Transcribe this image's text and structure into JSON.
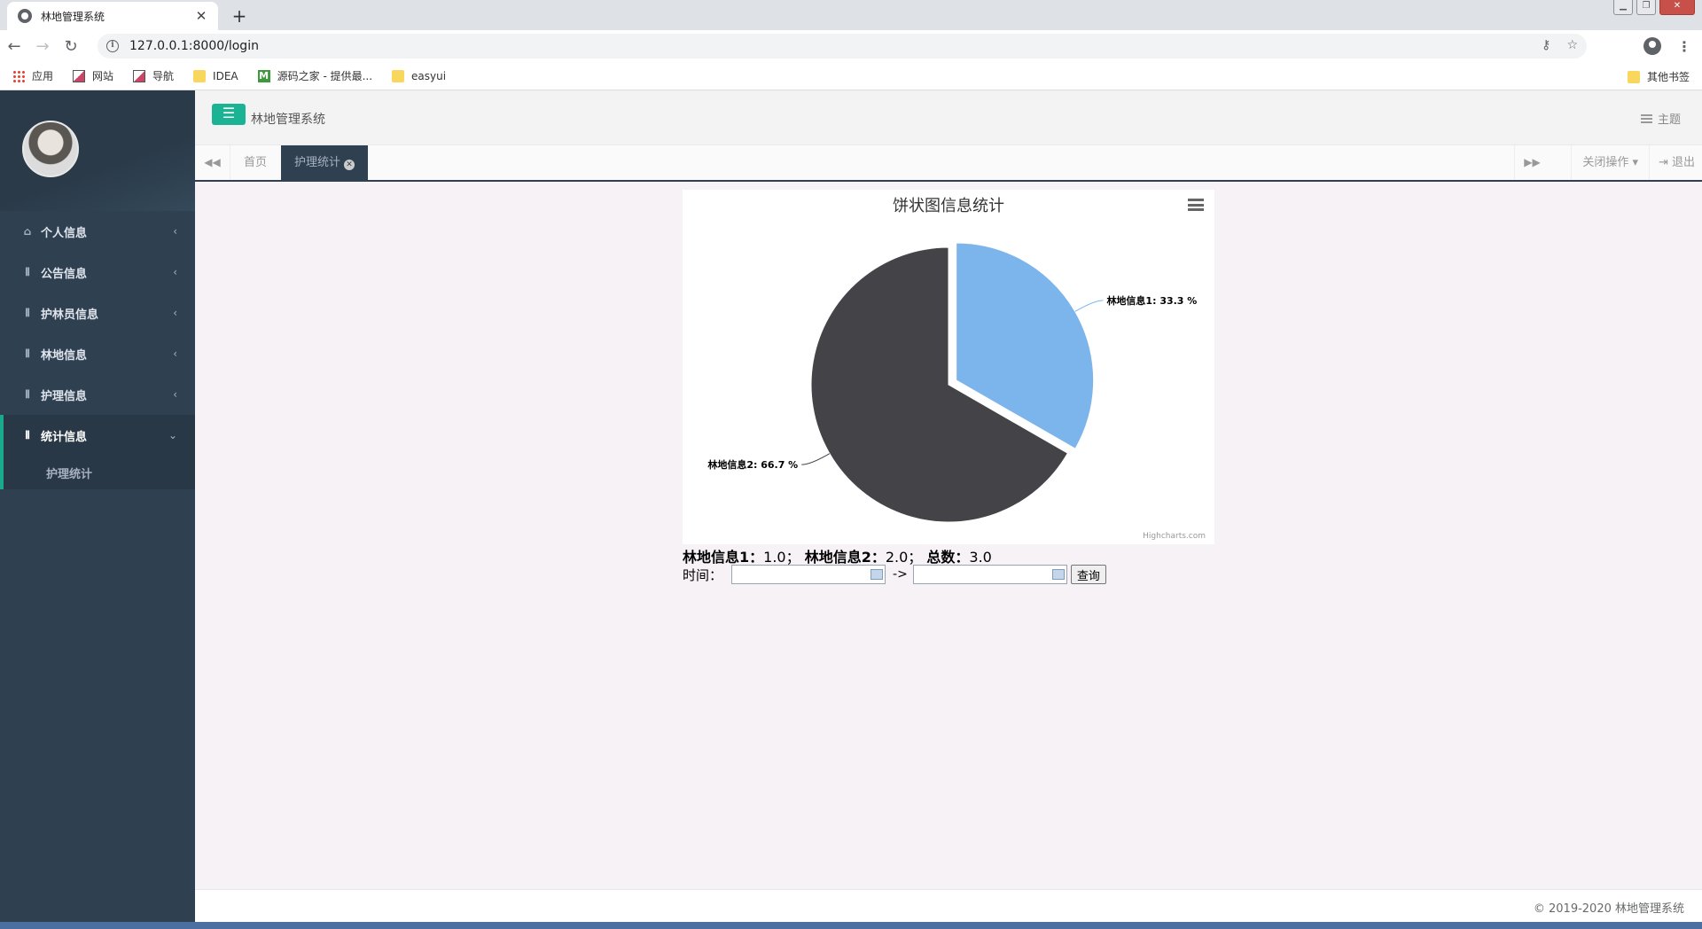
{
  "browser": {
    "tab_title": "林地管理系统",
    "tab_close": "✕",
    "new_tab": "+",
    "url": "127.0.0.1:8000/login",
    "bookmarks": [
      {
        "label": "应用",
        "icon": "apps-icon"
      },
      {
        "label": "网站",
        "icon": "image-icon"
      },
      {
        "label": "导航",
        "icon": "image-icon"
      },
      {
        "label": "IDEA",
        "icon": "folder-icon"
      },
      {
        "label": "源码之家 - 提供最...",
        "icon": "m-icon"
      },
      {
        "label": "easyui",
        "icon": "folder-icon"
      }
    ],
    "other_bookmarks": "其他书签"
  },
  "sidebar": {
    "items": [
      {
        "label": "个人信息",
        "icon": "home-icon"
      },
      {
        "label": "公告信息",
        "icon": "cutlery-icon"
      },
      {
        "label": "护林员信息",
        "icon": "cutlery-icon"
      },
      {
        "label": "林地信息",
        "icon": "cutlery-icon"
      },
      {
        "label": "护理信息",
        "icon": "cutlery-icon"
      }
    ],
    "active_item": {
      "label": "统计信息",
      "icon": "cutlery-icon"
    },
    "subitems": [
      {
        "label": "护理统计"
      }
    ]
  },
  "header": {
    "title": "林地管理系统",
    "theme_label": "主题"
  },
  "tabs": {
    "items": [
      {
        "label": "首页",
        "active": false
      },
      {
        "label": "护理统计",
        "active": true
      }
    ],
    "close_ops_label": "关闭操作",
    "logout_label": "退出"
  },
  "chart_data": {
    "type": "pie",
    "title": "饼状图信息统计",
    "credits": "Highcharts.com",
    "slices": [
      {
        "name": "林地信息1",
        "value": 33.3,
        "label": "林地信息1: 33.3 %",
        "color": "#7cb5ec",
        "sliced": true
      },
      {
        "name": "林地信息2",
        "value": 66.7,
        "label": "林地信息2: 66.7 %",
        "color": "#434348",
        "sliced": false
      }
    ]
  },
  "summary": {
    "item1_label": "林地信息1：",
    "item1_value": "1.0；",
    "item2_label": "林地信息2：",
    "item2_value": "2.0；",
    "total_label": "总数：",
    "total_value": "3.0"
  },
  "query": {
    "time_label": "时间：",
    "start_value": "",
    "end_value": "",
    "separator": "->",
    "button_label": "查询"
  },
  "footer": {
    "copyright": "© 2019-2020 林地管理系统"
  },
  "colors": {
    "sidebar_bg": "#2f4050",
    "accent": "#1ab394",
    "content_bg": "#f7f2f6"
  }
}
